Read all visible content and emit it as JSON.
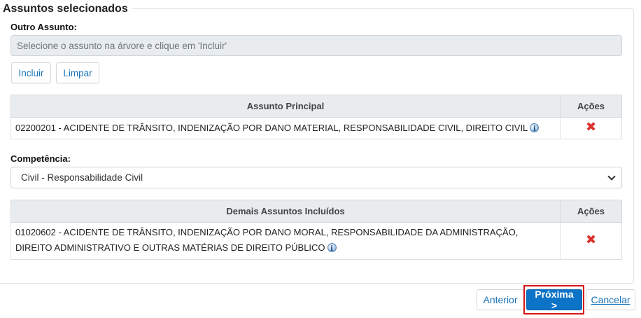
{
  "panel": {
    "title": "Assuntos selecionados"
  },
  "outro_assunto": {
    "label": "Outro Assunto:",
    "placeholder": "Selecione o assunto na árvore e clique em 'Incluir'",
    "value": ""
  },
  "actions": {
    "incluir": "Incluir",
    "limpar": "Limpar"
  },
  "principal_table": {
    "headers": [
      "Assunto Principal",
      "Ações"
    ],
    "rows": [
      {
        "text": "02200201 - ACIDENTE DE TRÂNSITO, INDENIZAÇÃO POR DANO MATERIAL, RESPONSABILIDADE CIVIL, DIREITO CIVIL",
        "action_icon": "remove-icon"
      }
    ]
  },
  "competencia": {
    "label": "Competência:",
    "selected": "Civil - Responsabilidade Civil"
  },
  "demais_table": {
    "headers": [
      "Demais Assuntos Incluídos",
      "Ações"
    ],
    "rows": [
      {
        "text": "01020602 - ACIDENTE DE TRÂNSITO, INDENIZAÇÃO POR DANO MORAL, RESPONSABILIDADE DA ADMINISTRAÇÃO, DIREITO ADMINISTRATIVO E OUTRAS MATÉRIAS DE DIREITO PÚBLICO",
        "action_icon": "remove-icon"
      }
    ]
  },
  "footer": {
    "anterior": "Anterior",
    "proxima": "Próxima >",
    "cancelar": "Cancelar"
  },
  "colors": {
    "accent": "#0d73c7",
    "link": "#1a74b8",
    "highlight": "#d7141a",
    "remove": "#d9322f"
  }
}
